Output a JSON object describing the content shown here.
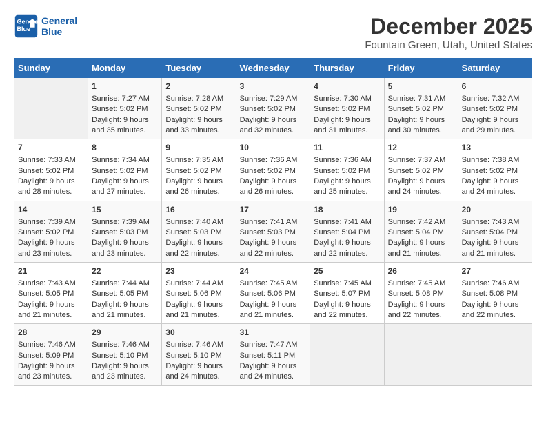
{
  "header": {
    "logo_line1": "General",
    "logo_line2": "Blue",
    "month": "December 2025",
    "location": "Fountain Green, Utah, United States"
  },
  "days_of_week": [
    "Sunday",
    "Monday",
    "Tuesday",
    "Wednesday",
    "Thursday",
    "Friday",
    "Saturday"
  ],
  "weeks": [
    [
      {
        "day": "",
        "empty": true
      },
      {
        "day": "1",
        "sunrise": "Sunrise: 7:27 AM",
        "sunset": "Sunset: 5:02 PM",
        "daylight": "Daylight: 9 hours and 35 minutes."
      },
      {
        "day": "2",
        "sunrise": "Sunrise: 7:28 AM",
        "sunset": "Sunset: 5:02 PM",
        "daylight": "Daylight: 9 hours and 33 minutes."
      },
      {
        "day": "3",
        "sunrise": "Sunrise: 7:29 AM",
        "sunset": "Sunset: 5:02 PM",
        "daylight": "Daylight: 9 hours and 32 minutes."
      },
      {
        "day": "4",
        "sunrise": "Sunrise: 7:30 AM",
        "sunset": "Sunset: 5:02 PM",
        "daylight": "Daylight: 9 hours and 31 minutes."
      },
      {
        "day": "5",
        "sunrise": "Sunrise: 7:31 AM",
        "sunset": "Sunset: 5:02 PM",
        "daylight": "Daylight: 9 hours and 30 minutes."
      },
      {
        "day": "6",
        "sunrise": "Sunrise: 7:32 AM",
        "sunset": "Sunset: 5:02 PM",
        "daylight": "Daylight: 9 hours and 29 minutes."
      }
    ],
    [
      {
        "day": "7",
        "sunrise": "Sunrise: 7:33 AM",
        "sunset": "Sunset: 5:02 PM",
        "daylight": "Daylight: 9 hours and 28 minutes."
      },
      {
        "day": "8",
        "sunrise": "Sunrise: 7:34 AM",
        "sunset": "Sunset: 5:02 PM",
        "daylight": "Daylight: 9 hours and 27 minutes."
      },
      {
        "day": "9",
        "sunrise": "Sunrise: 7:35 AM",
        "sunset": "Sunset: 5:02 PM",
        "daylight": "Daylight: 9 hours and 26 minutes."
      },
      {
        "day": "10",
        "sunrise": "Sunrise: 7:36 AM",
        "sunset": "Sunset: 5:02 PM",
        "daylight": "Daylight: 9 hours and 26 minutes."
      },
      {
        "day": "11",
        "sunrise": "Sunrise: 7:36 AM",
        "sunset": "Sunset: 5:02 PM",
        "daylight": "Daylight: 9 hours and 25 minutes."
      },
      {
        "day": "12",
        "sunrise": "Sunrise: 7:37 AM",
        "sunset": "Sunset: 5:02 PM",
        "daylight": "Daylight: 9 hours and 24 minutes."
      },
      {
        "day": "13",
        "sunrise": "Sunrise: 7:38 AM",
        "sunset": "Sunset: 5:02 PM",
        "daylight": "Daylight: 9 hours and 24 minutes."
      }
    ],
    [
      {
        "day": "14",
        "sunrise": "Sunrise: 7:39 AM",
        "sunset": "Sunset: 5:02 PM",
        "daylight": "Daylight: 9 hours and 23 minutes."
      },
      {
        "day": "15",
        "sunrise": "Sunrise: 7:39 AM",
        "sunset": "Sunset: 5:03 PM",
        "daylight": "Daylight: 9 hours and 23 minutes."
      },
      {
        "day": "16",
        "sunrise": "Sunrise: 7:40 AM",
        "sunset": "Sunset: 5:03 PM",
        "daylight": "Daylight: 9 hours and 22 minutes."
      },
      {
        "day": "17",
        "sunrise": "Sunrise: 7:41 AM",
        "sunset": "Sunset: 5:03 PM",
        "daylight": "Daylight: 9 hours and 22 minutes."
      },
      {
        "day": "18",
        "sunrise": "Sunrise: 7:41 AM",
        "sunset": "Sunset: 5:04 PM",
        "daylight": "Daylight: 9 hours and 22 minutes."
      },
      {
        "day": "19",
        "sunrise": "Sunrise: 7:42 AM",
        "sunset": "Sunset: 5:04 PM",
        "daylight": "Daylight: 9 hours and 21 minutes."
      },
      {
        "day": "20",
        "sunrise": "Sunrise: 7:43 AM",
        "sunset": "Sunset: 5:04 PM",
        "daylight": "Daylight: 9 hours and 21 minutes."
      }
    ],
    [
      {
        "day": "21",
        "sunrise": "Sunrise: 7:43 AM",
        "sunset": "Sunset: 5:05 PM",
        "daylight": "Daylight: 9 hours and 21 minutes."
      },
      {
        "day": "22",
        "sunrise": "Sunrise: 7:44 AM",
        "sunset": "Sunset: 5:05 PM",
        "daylight": "Daylight: 9 hours and 21 minutes."
      },
      {
        "day": "23",
        "sunrise": "Sunrise: 7:44 AM",
        "sunset": "Sunset: 5:06 PM",
        "daylight": "Daylight: 9 hours and 21 minutes."
      },
      {
        "day": "24",
        "sunrise": "Sunrise: 7:45 AM",
        "sunset": "Sunset: 5:06 PM",
        "daylight": "Daylight: 9 hours and 21 minutes."
      },
      {
        "day": "25",
        "sunrise": "Sunrise: 7:45 AM",
        "sunset": "Sunset: 5:07 PM",
        "daylight": "Daylight: 9 hours and 22 minutes."
      },
      {
        "day": "26",
        "sunrise": "Sunrise: 7:45 AM",
        "sunset": "Sunset: 5:08 PM",
        "daylight": "Daylight: 9 hours and 22 minutes."
      },
      {
        "day": "27",
        "sunrise": "Sunrise: 7:46 AM",
        "sunset": "Sunset: 5:08 PM",
        "daylight": "Daylight: 9 hours and 22 minutes."
      }
    ],
    [
      {
        "day": "28",
        "sunrise": "Sunrise: 7:46 AM",
        "sunset": "Sunset: 5:09 PM",
        "daylight": "Daylight: 9 hours and 23 minutes."
      },
      {
        "day": "29",
        "sunrise": "Sunrise: 7:46 AM",
        "sunset": "Sunset: 5:10 PM",
        "daylight": "Daylight: 9 hours and 23 minutes."
      },
      {
        "day": "30",
        "sunrise": "Sunrise: 7:46 AM",
        "sunset": "Sunset: 5:10 PM",
        "daylight": "Daylight: 9 hours and 24 minutes."
      },
      {
        "day": "31",
        "sunrise": "Sunrise: 7:47 AM",
        "sunset": "Sunset: 5:11 PM",
        "daylight": "Daylight: 9 hours and 24 minutes."
      },
      {
        "day": "",
        "empty": true
      },
      {
        "day": "",
        "empty": true
      },
      {
        "day": "",
        "empty": true
      }
    ]
  ]
}
